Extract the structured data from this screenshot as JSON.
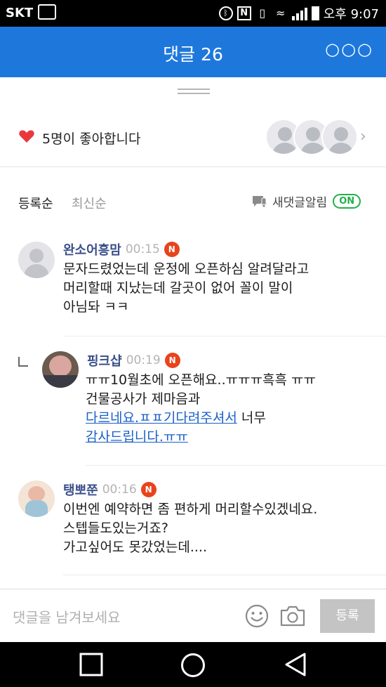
{
  "status_bar": {
    "carrier": "SKT",
    "time": "오후 9:07"
  },
  "header": {
    "title": "댓글 26",
    "more_icon": "more-dots-icon"
  },
  "likes": {
    "text": "5명이 좋아합니다",
    "heart_color": "#e8383d"
  },
  "sort": {
    "registered": "등록순",
    "newest": "최신순"
  },
  "notify": {
    "label": "새댓글알림",
    "state": "ON"
  },
  "comments": [
    {
      "name": "완소어흥맘",
      "time": "00:15",
      "badge": "N",
      "lines": [
        "문자드렸었는데 운정에 오픈하심 알려달라고",
        "머리할때 지났는데 갈곳이 없어 꼴이 말이",
        "아님돠 ㅋㅋ"
      ]
    },
    {
      "name": "핑크샵",
      "time": "00:19",
      "badge": "N",
      "lines": [
        "ㅠㅠ10월초에 오픈해요..ㅠㅠㅠ흑흑 ㅠㅠ",
        "건물공사가 제마음과"
      ],
      "link_line1": "다르네요.ㅍㅍ기다려주셔서",
      "link_line1_tail": " 너무",
      "link_line2": "감사드립니다.ㅠㅠ"
    },
    {
      "name": "탱뽀쭌",
      "time": "00:16",
      "badge": "N",
      "lines": [
        "이번엔 예약하면 좀 편하게 머리할수있겠네요.",
        "스텝들도있는거죠?",
        "가고싶어도 못갔었는데...."
      ]
    }
  ],
  "input": {
    "placeholder": "댓글을 남겨보세요",
    "submit": "등록"
  },
  "colors": {
    "header_bg": "#1e78dc",
    "badge_bg": "#e8431c",
    "on_green": "#22b04a",
    "link": "#1a60c9"
  }
}
